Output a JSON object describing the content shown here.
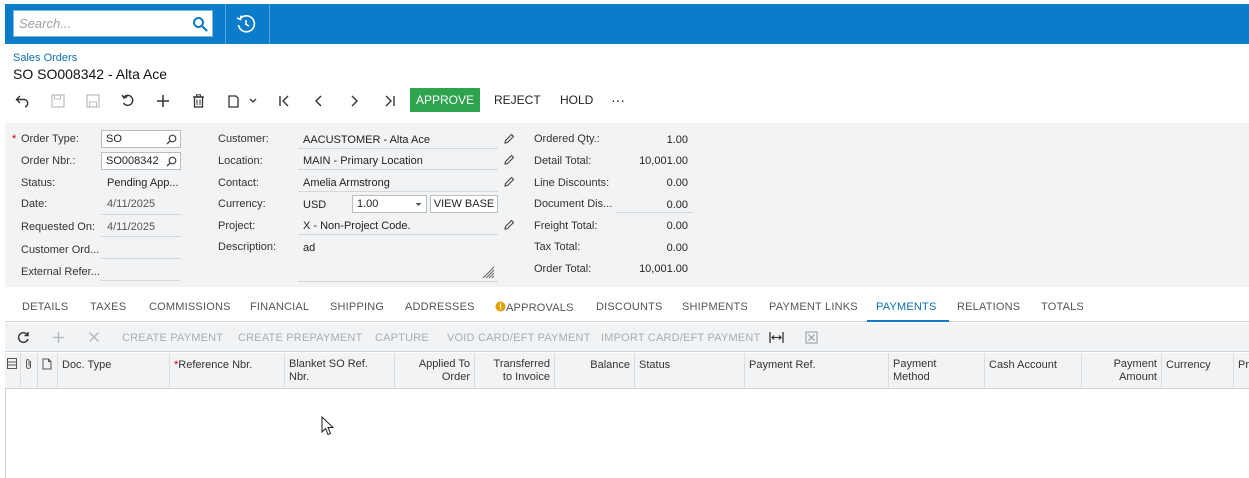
{
  "search": {
    "placeholder": "Search..."
  },
  "breadcrumb": "Sales Orders",
  "title": "SO SO008342 - Alta Ace",
  "toolbar": {
    "approve": "APPROVE",
    "reject": "REJECT",
    "hold": "HOLD",
    "more": "···"
  },
  "form": {
    "order_type_label": "Order Type:",
    "order_type": "SO",
    "order_nbr_label": "Order Nbr.:",
    "order_nbr": "SO008342",
    "status_label": "Status:",
    "status": "Pending App...",
    "date_label": "Date:",
    "date": "4/11/2025",
    "requested_on_label": "Requested On:",
    "requested_on": "4/11/2025",
    "customer_ord_label": "Customer Ord...",
    "external_ref_label": "External Refer...",
    "customer_label": "Customer:",
    "customer": "AACUSTOMER - Alta Ace",
    "location_label": "Location:",
    "location": "MAIN - Primary Location",
    "contact_label": "Contact:",
    "contact": "Amelia Armstrong",
    "currency_label": "Currency:",
    "currency": "USD",
    "rate": "1.00",
    "view_base": "VIEW BASE",
    "project_label": "Project:",
    "project": "X - Non-Project Code.",
    "description_label": "Description:",
    "description": "ad",
    "ordered_qty_label": "Ordered Qty.:",
    "ordered_qty": "1.00",
    "detail_total_label": "Detail Total:",
    "detail_total": "10,001.00",
    "line_discounts_label": "Line Discounts:",
    "line_discounts": "0.00",
    "document_dis_label": "Document Dis...",
    "document_dis": "0.00",
    "freight_total_label": "Freight Total:",
    "freight_total": "0.00",
    "tax_total_label": "Tax Total:",
    "tax_total": "0.00",
    "order_total_label": "Order Total:",
    "order_total": "10,001.00"
  },
  "tabs": [
    "DETAILS",
    "TAXES",
    "COMMISSIONS",
    "FINANCIAL",
    "SHIPPING",
    "ADDRESSES",
    "APPROVALS",
    "DISCOUNTS",
    "SHIPMENTS",
    "PAYMENT LINKS",
    "PAYMENTS",
    "RELATIONS",
    "TOTALS"
  ],
  "active_tab": "PAYMENTS",
  "grid_actions": [
    "CREATE PAYMENT",
    "CREATE PREPAYMENT",
    "CAPTURE",
    "VOID CARD/EFT PAYMENT",
    "IMPORT CARD/EFT PAYMENT"
  ],
  "grid_columns": {
    "doc_type": "Doc. Type",
    "reference_nbr": "Reference Nbr.",
    "blanket_so_1": "Blanket SO Ref.",
    "blanket_so_2": "Nbr.",
    "applied_1": "Applied To",
    "applied_2": "Order",
    "transferred_1": "Transferred",
    "transferred_2": "to Invoice",
    "balance": "Balance",
    "status": "Status",
    "payment_ref": "Payment Ref.",
    "payment_method_1": "Payment",
    "payment_method_2": "Method",
    "cash_account": "Cash Account",
    "payment_amount_1": "Payment",
    "payment_amount_2": "Amount",
    "currency": "Currency",
    "overflow": "Pr"
  },
  "colors": {
    "brand": "#0a7cc9",
    "approve": "#2ea44f",
    "link": "#0a6fb8"
  }
}
